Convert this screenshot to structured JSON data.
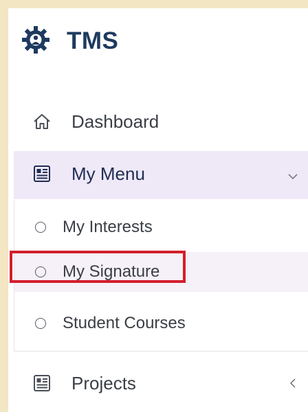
{
  "brand": {
    "title": "TMS",
    "logo_icon": "gear-logo-icon"
  },
  "nav": {
    "dashboard": {
      "label": "Dashboard",
      "icon": "home-icon"
    },
    "my_menu": {
      "label": "My Menu",
      "icon": "newspaper-icon",
      "expanded": true,
      "items": [
        {
          "label": "My Interests"
        },
        {
          "label": "My Signature",
          "active": true
        },
        {
          "label": "Student Courses"
        }
      ]
    },
    "projects": {
      "label": "Projects",
      "icon": "newspaper-icon",
      "expanded": false
    }
  },
  "colors": {
    "background": "#f3e6c3",
    "brand_text": "#1e3a5f",
    "active_section": "#efe8f7",
    "highlight_border": "#d21f2b"
  }
}
